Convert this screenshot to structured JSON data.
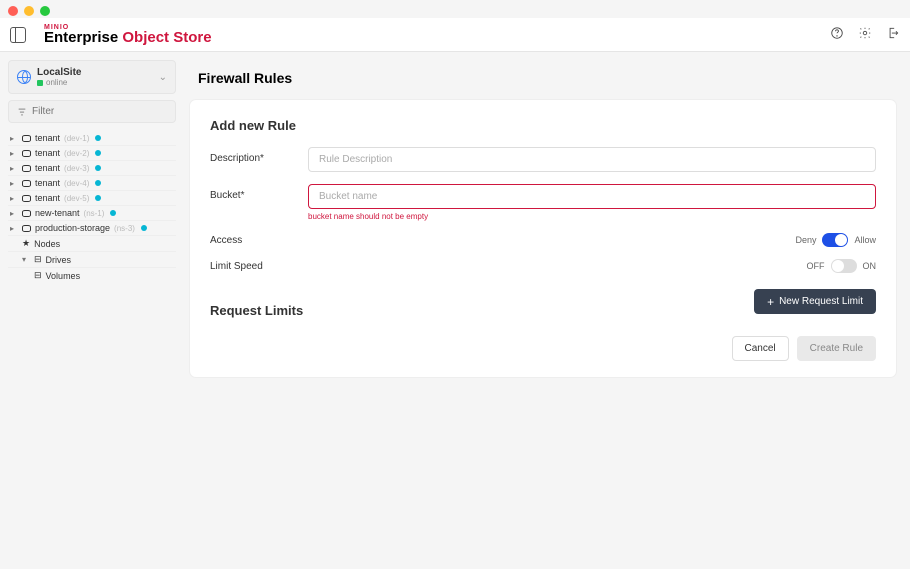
{
  "brand": {
    "small": "MINIO",
    "big1": "Enterprise ",
    "big2": "Object Store"
  },
  "site": {
    "name": "LocalSite",
    "status": "online"
  },
  "filter": {
    "placeholder": "Filter"
  },
  "tree": {
    "tenants": [
      {
        "label": "tenant",
        "tag": "(dev-1)"
      },
      {
        "label": "tenant",
        "tag": "(dev-2)"
      },
      {
        "label": "tenant",
        "tag": "(dev-3)"
      },
      {
        "label": "tenant",
        "tag": "(dev-4)"
      },
      {
        "label": "tenant",
        "tag": "(dev-5)"
      },
      {
        "label": "new-tenant",
        "tag": "(ns-1)"
      },
      {
        "label": "production-storage",
        "tag": "(ns-3)"
      }
    ],
    "nodes": "Nodes",
    "drives": "Drives",
    "volumes": "Volumes"
  },
  "page": {
    "title": "Firewall Rules"
  },
  "form": {
    "heading": "Add new Rule",
    "description_label": "Description*",
    "description_placeholder": "Rule Description",
    "bucket_label": "Bucket*",
    "bucket_placeholder": "Bucket name",
    "bucket_error": "bucket name should not be empty",
    "access_label": "Access",
    "access_left": "Deny",
    "access_right": "Allow",
    "limit_label": "Limit Speed",
    "limit_left": "OFF",
    "limit_right": "ON",
    "request_heading": "Request Limits",
    "new_limit_btn": "New Request Limit",
    "cancel": "Cancel",
    "create": "Create Rule"
  }
}
